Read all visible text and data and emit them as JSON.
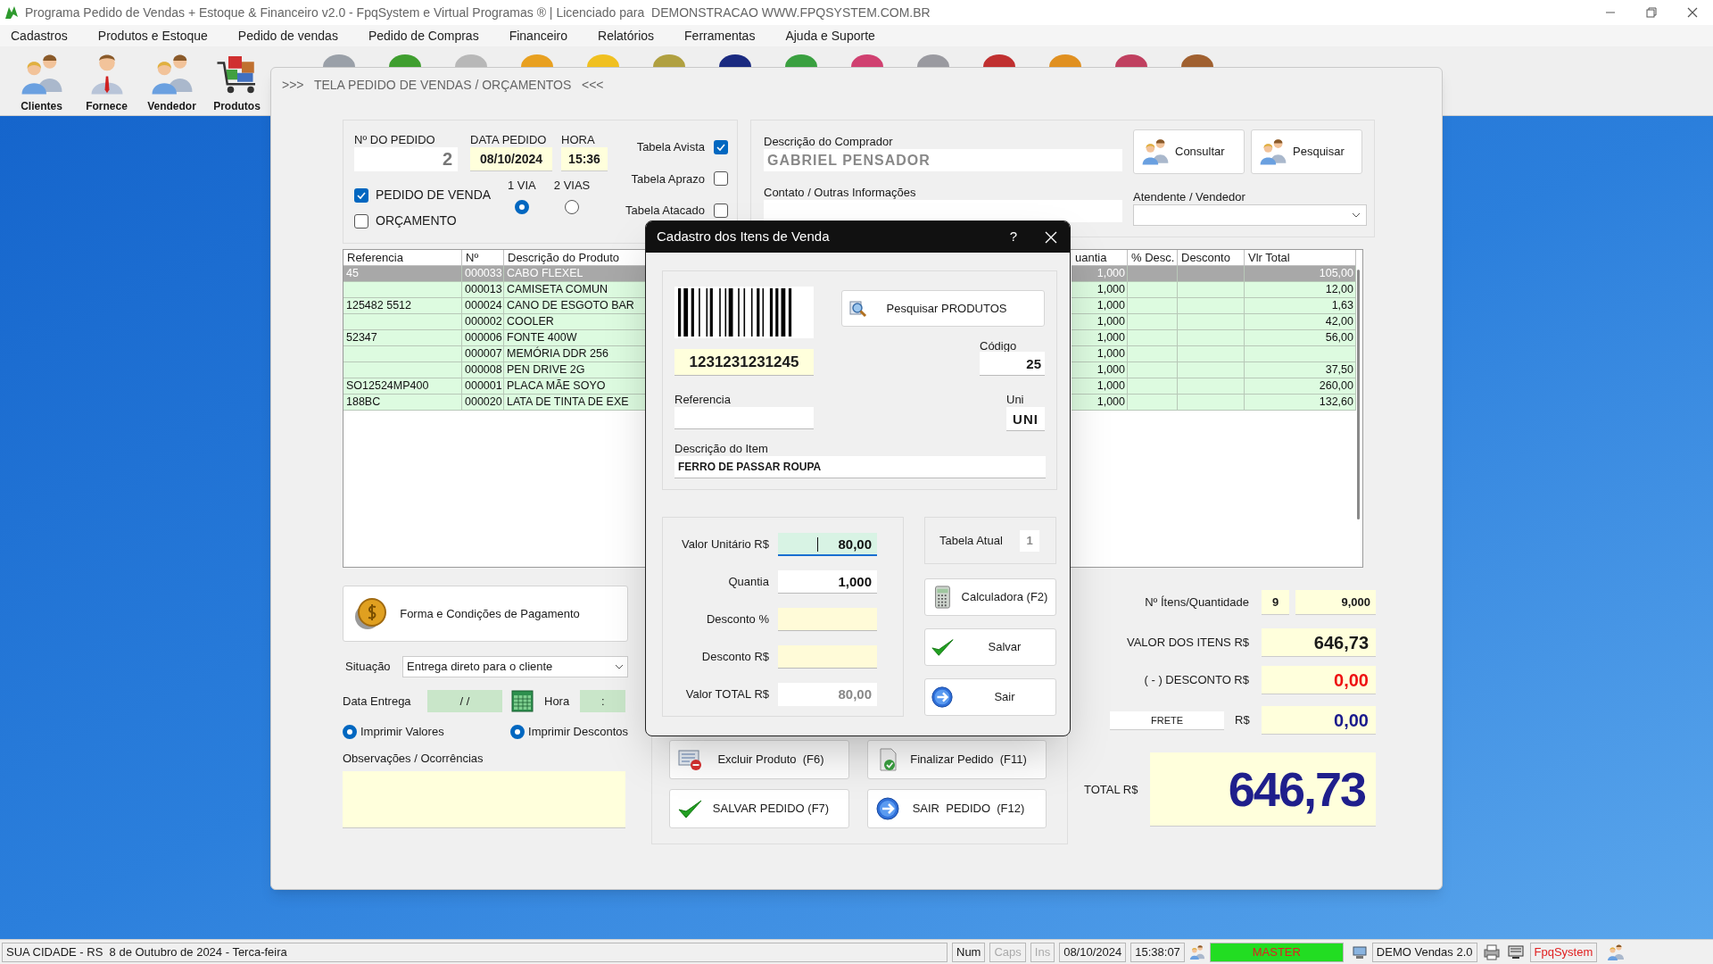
{
  "window": {
    "title": "Programa Pedido de Vendas + Estoque & Financeiro v2.0 - FpqSystem e Virtual Programas ® | Licenciado para  DEMONSTRACAO WWW.FPQSYSTEM.COM.BR"
  },
  "menu": [
    "Cadastros",
    "Produtos e Estoque",
    "Pedido de vendas",
    "Pedido de Compras",
    "Financeiro",
    "Relatórios",
    "Ferramentas",
    "Ajuda e Suporte"
  ],
  "toolbar": [
    {
      "label": "Clientes",
      "kind": "people"
    },
    {
      "label": "Fornece",
      "kind": "person"
    },
    {
      "label": "Vendedor",
      "kind": "people"
    },
    {
      "label": "Produtos",
      "kind": "cart"
    }
  ],
  "order_window": {
    "header": ">>>   TELA PEDIDO DE VENDAS / ORÇAMENTOS   <<<"
  },
  "order": {
    "number_label": "Nº DO PEDIDO",
    "number": "2",
    "date_label": "DATA PEDIDO",
    "date": "08/10/2024",
    "time_label": "HORA",
    "time": "15:36",
    "types": [
      {
        "label": "PEDIDO DE VENDA",
        "checked": true
      },
      {
        "label": "ORÇAMENTO",
        "checked": false
      }
    ],
    "copies": [
      {
        "label": "1 VIA",
        "selected": true
      },
      {
        "label": "2 VIAS",
        "selected": false
      }
    ],
    "price_tables": [
      {
        "label": "Tabela Avista",
        "checked": true
      },
      {
        "label": "Tabela Aprazo",
        "checked": false
      },
      {
        "label": "Tabela Atacado",
        "checked": false
      }
    ]
  },
  "buyer": {
    "label": "Descrição do Comprador",
    "value": "GABRIEL PENSADOR",
    "contact_label": "Contato / Outras Informações",
    "seller_label": "Atendente / Vendedor",
    "buttons": [
      "Consultar",
      "Pesquisar"
    ]
  },
  "table": {
    "columns": [
      "Referencia",
      "Nº",
      "Descrição do Produto",
      "uantia",
      "% Desc.",
      "Desconto",
      "Vlr Total"
    ],
    "rows": [
      {
        "ref": "45",
        "no": "000033",
        "desc": "CABO FLEXEL",
        "qty": "1,000",
        "total": "105,00",
        "selected": true
      },
      {
        "no": "000013",
        "desc": "CAMISETA COMUN",
        "qty": "1,000",
        "total": "12,00",
        "selected": false
      },
      {
        "ref": "125482 5512",
        "no": "000024",
        "desc": "CANO DE ESGOTO BAR",
        "qty": "1,000",
        "total": "1,63",
        "selected": false
      },
      {
        "no": "000002",
        "desc": "COOLER",
        "qty": "1,000",
        "total": "42,00",
        "selected": false
      },
      {
        "ref": "52347",
        "no": "000006",
        "desc": "FONTE 400W",
        "qty": "1,000",
        "total": "56,00",
        "selected": false
      },
      {
        "no": "000007",
        "desc": "MEMÓRIA DDR 256",
        "qty": "1,000",
        "selected": false
      },
      {
        "no": "000008",
        "desc": "PEN DRIVE 2G",
        "qty": "1,000",
        "total": "37,50",
        "selected": false
      },
      {
        "ref": "SO12524MP400",
        "no": "000001",
        "desc": "PLACA MÃE SOYO",
        "qty": "1,000",
        "total": "260,00",
        "selected": false
      },
      {
        "ref": "188BC",
        "no": "000020",
        "desc": "LATA DE TINTA DE EXE",
        "qty": "1,000",
        "total": "132,60",
        "selected": false
      }
    ]
  },
  "payment": {
    "button": "Forma e Condições de Pagamento",
    "situation_label": "Situação",
    "situation": "Entrega direto para o cliente",
    "delivery_label": "Data Entrega",
    "delivery_date": "/ /",
    "time_label": "Hora",
    "delivery_time": ":",
    "print_options": [
      {
        "label": "Imprimir Valores",
        "checked": true
      },
      {
        "label": "Imprimir Descontos",
        "checked": true
      }
    ],
    "notes_label": "Observações / Ocorrências"
  },
  "actions": [
    {
      "label": "Excluir Produto  (F6)",
      "kind": "delete"
    },
    {
      "label": "Finalizar Pedido  (F11)",
      "kind": "finish"
    },
    {
      "label": "SALVAR PEDIDO (F7)",
      "kind": "save"
    },
    {
      "label": "SAIR  PEDIDO  (F12)",
      "kind": "exit"
    }
  ],
  "totals": {
    "items_label": "Nº Ítens/Quantidade",
    "items_count": "9",
    "items_qty": "9,000",
    "items_value_label": "VALOR DOS ITENS R$",
    "items_value": "646,73",
    "discount_label": "( - ) DESCONTO R$",
    "discount": "0,00",
    "freight_label": "FRETE",
    "freight_currency": "R$",
    "freight": "0,00",
    "total_label": "TOTAL R$",
    "total": "646,73"
  },
  "dialog": {
    "title": "Cadastro dos Itens de Venda",
    "help": "?",
    "barcode": "1231231231245",
    "search_button": "Pesquisar PRODUTOS",
    "code_label": "Código",
    "code": "25",
    "reference_label": "Referencia",
    "unit_label": "Uni",
    "unit": "UNI",
    "description_label": "Descrição do Item",
    "description": "FERRO DE PASSAR ROUPA",
    "price_fields": [
      {
        "label": "Valor Unitário R$",
        "value": "80,00",
        "kind": "focused"
      },
      {
        "label": "Quantia",
        "value": "1,000",
        "kind": "plain"
      },
      {
        "label": "Desconto %",
        "kind": "discount"
      },
      {
        "label": "Desconto R$",
        "kind": "discount"
      },
      {
        "label": "Valor TOTAL R$",
        "value": "80,00",
        "kind": "readonly"
      }
    ],
    "table_label": "Tabela Atual",
    "table_value": "1",
    "buttons": [
      {
        "label": "Calculadora (F2)",
        "kind": "calculator"
      },
      {
        "label": "Salvar",
        "kind": "save"
      },
      {
        "label": "Sair",
        "kind": "exit"
      }
    ]
  },
  "status_bar": {
    "location": "SUA CIDADE - RS  8 de Outubro de 2024 - Terca-feira",
    "keys": [
      {
        "label": "Num",
        "on": true
      },
      {
        "label": "Caps",
        "on": false
      },
      {
        "label": "Ins",
        "on": false
      }
    ],
    "date": "08/10/2024",
    "time": "15:38:07",
    "user": "MASTER",
    "product": "DEMO Vendas 2.0",
    "brand": "FpqSystem"
  }
}
